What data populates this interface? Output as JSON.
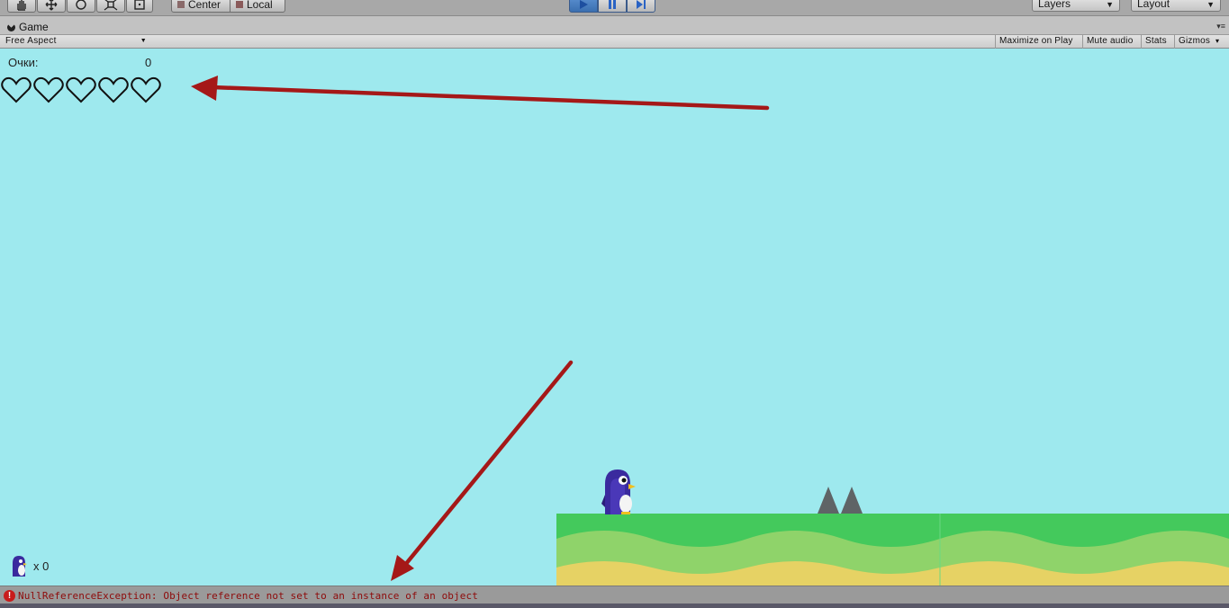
{
  "toolbar": {
    "tools": [
      {
        "name": "hand-icon"
      },
      {
        "name": "move-icon"
      },
      {
        "name": "rotate-icon"
      },
      {
        "name": "scale-icon"
      },
      {
        "name": "rect-tool-icon"
      }
    ],
    "pivot_center_label": "Center",
    "pivot_local_label": "Local",
    "play_icon": "play-icon",
    "pause_icon": "pause-icon",
    "step_icon": "step-icon",
    "layers_label": "Layers",
    "layout_label": "Layout"
  },
  "game_tab": {
    "title": "Game",
    "aspect": "Free Aspect",
    "buttons": [
      "Maximize on Play",
      "Mute audio",
      "Stats",
      "Gizmos"
    ]
  },
  "hud": {
    "score_label": "Очки:",
    "score_value": "0",
    "hearts_count": 5,
    "lives_text": "x 0"
  },
  "status": {
    "message": "NullReferenceException: Object reference not set to an instance of an object",
    "icon": "error-icon",
    "color": "#8e0a0a"
  },
  "colors": {
    "sky": "#9ee9ee",
    "grass": "#44c95c",
    "grass_light": "#8fd36a",
    "sand": "#e6d264",
    "arrow": "#a51818",
    "penguin": "#3a2a9e"
  }
}
